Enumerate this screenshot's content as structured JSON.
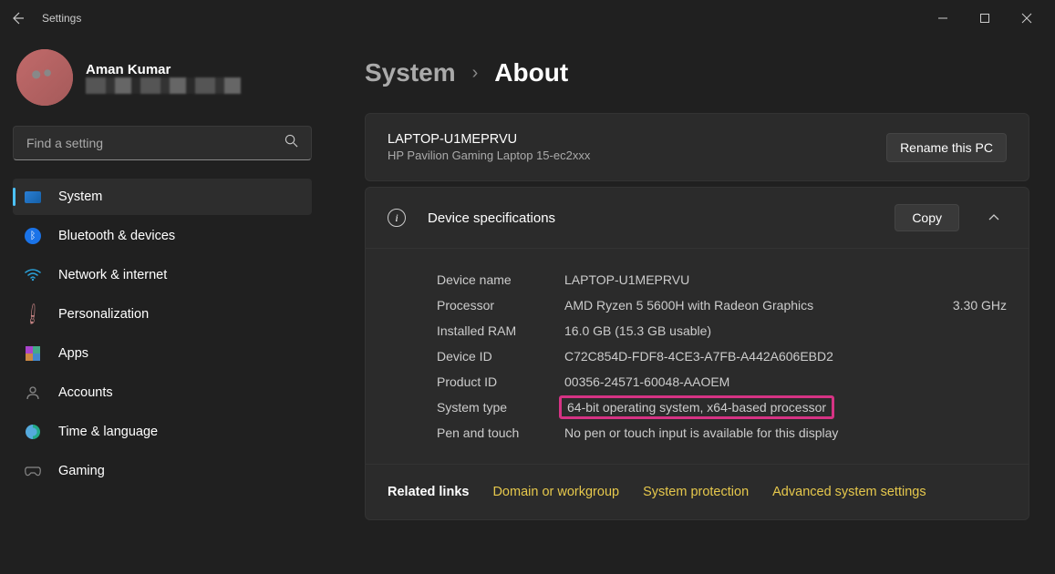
{
  "titlebar": {
    "title": "Settings"
  },
  "profile": {
    "name": "Aman Kumar"
  },
  "search": {
    "placeholder": "Find a setting"
  },
  "sidebar": {
    "items": [
      {
        "label": "System"
      },
      {
        "label": "Bluetooth & devices"
      },
      {
        "label": "Network & internet"
      },
      {
        "label": "Personalization"
      },
      {
        "label": "Apps"
      },
      {
        "label": "Accounts"
      },
      {
        "label": "Time & language"
      },
      {
        "label": "Gaming"
      }
    ]
  },
  "breadcrumb": {
    "parent": "System",
    "current": "About"
  },
  "device": {
    "name": "LAPTOP-U1MEPRVU",
    "model": "HP Pavilion Gaming Laptop 15-ec2xxx",
    "rename_label": "Rename this PC"
  },
  "spec": {
    "title": "Device specifications",
    "copy_label": "Copy",
    "rows": [
      {
        "label": "Device name",
        "value": "LAPTOP-U1MEPRVU",
        "extra": ""
      },
      {
        "label": "Processor",
        "value": "AMD Ryzen 5 5600H with Radeon Graphics",
        "extra": "3.30 GHz"
      },
      {
        "label": "Installed RAM",
        "value": "16.0 GB (15.3 GB usable)",
        "extra": ""
      },
      {
        "label": "Device ID",
        "value": "C72C854D-FDF8-4CE3-A7FB-A442A606EBD2",
        "extra": ""
      },
      {
        "label": "Product ID",
        "value": "00356-24571-60048-AAOEM",
        "extra": ""
      },
      {
        "label": "System type",
        "value": "64-bit operating system, x64-based processor",
        "extra": ""
      },
      {
        "label": "Pen and touch",
        "value": "No pen or touch input is available for this display",
        "extra": ""
      }
    ]
  },
  "related": {
    "label": "Related links",
    "links": [
      "Domain or workgroup",
      "System protection",
      "Advanced system settings"
    ]
  }
}
